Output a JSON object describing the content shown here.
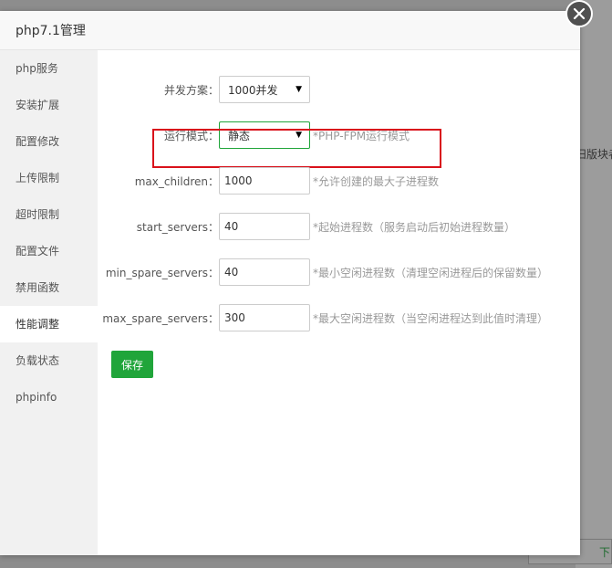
{
  "dialog": {
    "title": "php7.1管理"
  },
  "sidebar": {
    "items": [
      {
        "label": "php服务"
      },
      {
        "label": "安装扩展"
      },
      {
        "label": "配置修改"
      },
      {
        "label": "上传限制"
      },
      {
        "label": "超时限制"
      },
      {
        "label": "配置文件"
      },
      {
        "label": "禁用函数"
      },
      {
        "label": "性能调整",
        "active": true
      },
      {
        "label": "负载状态"
      },
      {
        "label": "phpinfo"
      }
    ]
  },
  "form": {
    "scheme": {
      "label": "并发方案：",
      "value": "1000并发"
    },
    "mode": {
      "label": "运行模式：",
      "value": "静态",
      "hint": "*PHP-FPM运行模式"
    },
    "max_children": {
      "label": "max_children：",
      "value": "1000",
      "hint": "*允许创建的最大子进程数"
    },
    "start_servers": {
      "label": "start_servers：",
      "value": "40",
      "hint": "*起始进程数（服务启动后初始进程数量）"
    },
    "min_spare_servers": {
      "label": "min_spare_servers：",
      "value": "40",
      "hint": "*最小空闲进程数（清理空闲进程后的保留数量）"
    },
    "max_spare_servers": {
      "label": "max_spare_servers：",
      "value": "300",
      "hint": "*最大空闲进程数（当空闲进程达到此值时清理）"
    },
    "save_label": "保存"
  },
  "background": {
    "side_text": "旧版块者",
    "corner_text": "下"
  },
  "colors": {
    "accent": "#20a53a",
    "highlight": "#d9111b"
  }
}
